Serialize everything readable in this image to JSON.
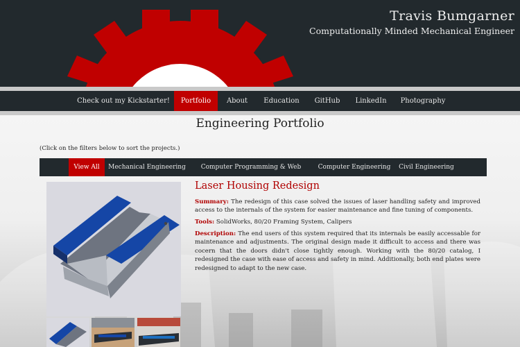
{
  "header": {
    "name": "Travis Bumgarner",
    "tagline": "Computationally Minded Mechanical Engineer",
    "accent": "#c00000"
  },
  "nav": {
    "items": [
      {
        "label": "Check out my Kickstarter!"
      },
      {
        "label": "Portfolio",
        "active": true
      },
      {
        "label": "About"
      },
      {
        "label": "Education"
      },
      {
        "label": "GitHub"
      },
      {
        "label": "LinkedIn"
      },
      {
        "label": "Photography"
      }
    ]
  },
  "page": {
    "title": "Engineering Portfolio",
    "filter_hint": "(Click on the filters below to sort the projects.)"
  },
  "filters": [
    {
      "label": "View All",
      "active": true
    },
    {
      "label": "Mechanical Engineering"
    },
    {
      "label": "Computer Programming & Web Design"
    },
    {
      "label": "Computer Engineering"
    },
    {
      "label": "Civil Engineering"
    }
  ],
  "project": {
    "title": "Laser Housing Redesign",
    "summary_label": "Summary:",
    "summary": "The redesign of this case solved the issues of laser handling safety and improved access to the internals of the system for easier maintenance and fine tuning of components.",
    "tools_label": "Tools:",
    "tools": "SolidWorks, 80/20 Framing System, Calipers",
    "description_label": "Description:",
    "description": "The end users of this system required that its internals be easily accessable for maintenance and adjustments. The original design made it difficult to access and there was cocern that the doors didn't close tightly enough. Working with the 80/20 catalog, I redesigned the case with ease of access and safety in mind. Additionally, both end plates were redesigned to adapt to the new case."
  }
}
